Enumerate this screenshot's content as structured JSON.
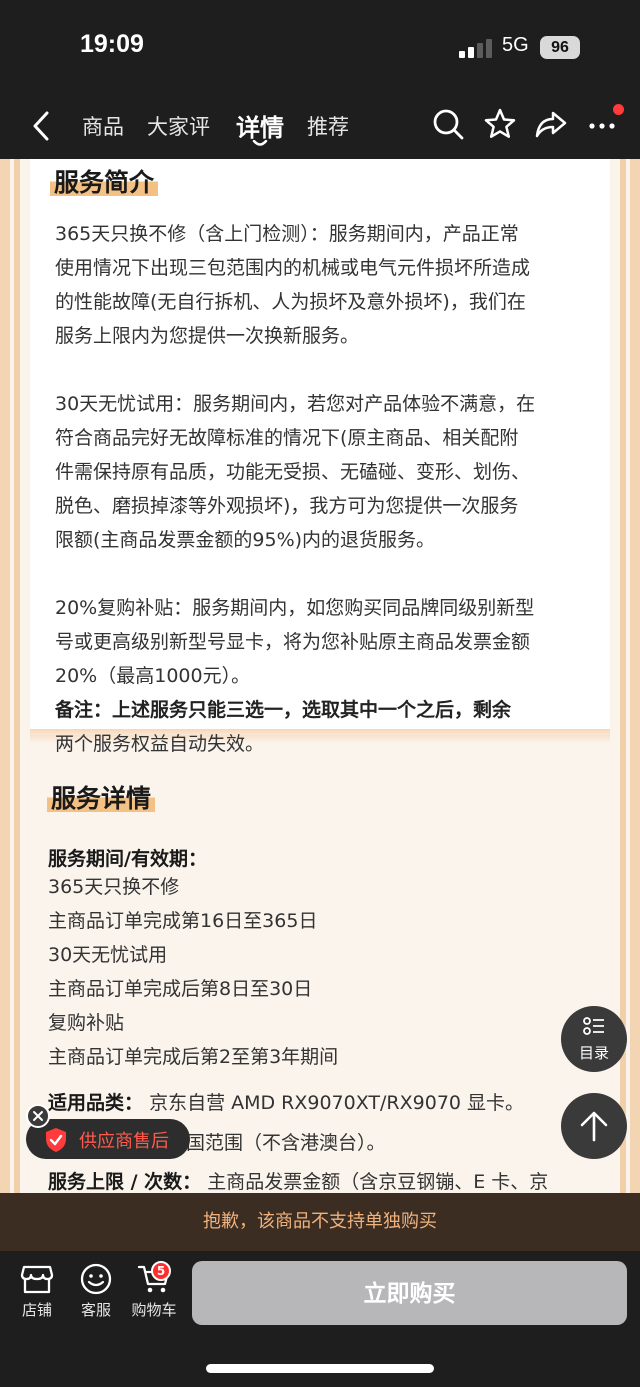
{
  "status_bar": {
    "time": "19:09",
    "network": "5G",
    "battery": "96"
  },
  "nav": {
    "tabs": [
      {
        "label": "商品"
      },
      {
        "label": "大家评"
      },
      {
        "label": "详情"
      },
      {
        "label": "推荐"
      }
    ],
    "active_tab": "详情"
  },
  "service_intro": {
    "title": "服务简介",
    "paragraphs": [
      [
        "365天只换不修（含上门检测）：服务期间内，产品正常",
        "使用情况下出现三包范围内的机械或电气元件损坏所造成",
        "的性能故障(无自行拆机、人为损坏及意外损坏)，我们在",
        "服务上限内为您提供一次换新服务。"
      ],
      [
        "30天无忧试用：服务期间内，若您对产品体验不满意，在",
        "符合商品完好无故障标准的情况下(原主商品、相关配附",
        "件需保持原有品质，功能无受损、无磕碰、变形、划伤、",
        "脱色、磨损掉漆等外观损坏)，我方可为您提供一次服务",
        "限额(主商品发票金额的95%)内的退货服务。"
      ],
      [
        "20%复购补贴：服务期间内，如您购买同品牌同级别新型",
        "号或更高级别新型号显卡，将为您补贴原主商品发票金额",
        "20%（最高1000元）。"
      ]
    ],
    "note": [
      "备注：上述服务只能三选一，选取其中一个之后，剩余",
      "两个服务权益自动失效。"
    ]
  },
  "service_detail": {
    "title": "服务详情",
    "period_label": "服务期间/有效期：",
    "period_lines": [
      "365天只换不修",
      "主商品订单完成第16日至365日",
      "30天无忧试用",
      "主商品订单完成后第8日至30日",
      "复购补贴",
      "主商品订单完成后第2至第3年期间"
    ],
    "category_label": "适用品类：",
    "category_value": "京东自营 AMD RX9070XT/RX9070 显卡。",
    "region_value": "国范围（不含港澳台）。",
    "limit_label": "服务上限 / 次数：",
    "limit_value": "主商品发票金额（含京豆钢镚、E 卡、京"
  },
  "floating": {
    "toc_label": "目录",
    "supplier_label": "供应商售后"
  },
  "notice": "抱歉，该商品不支持单独购买",
  "bottom": {
    "store_label": "店铺",
    "service_label": "客服",
    "cart_label": "购物车",
    "cart_count": "5",
    "buy_label": "立即购买"
  },
  "colors": {
    "accent_highlight": "#f4c185",
    "notice_text": "#f1b27d",
    "supplier_red": "#ff5a4e",
    "buy_disabled": "#b7b7b9"
  }
}
